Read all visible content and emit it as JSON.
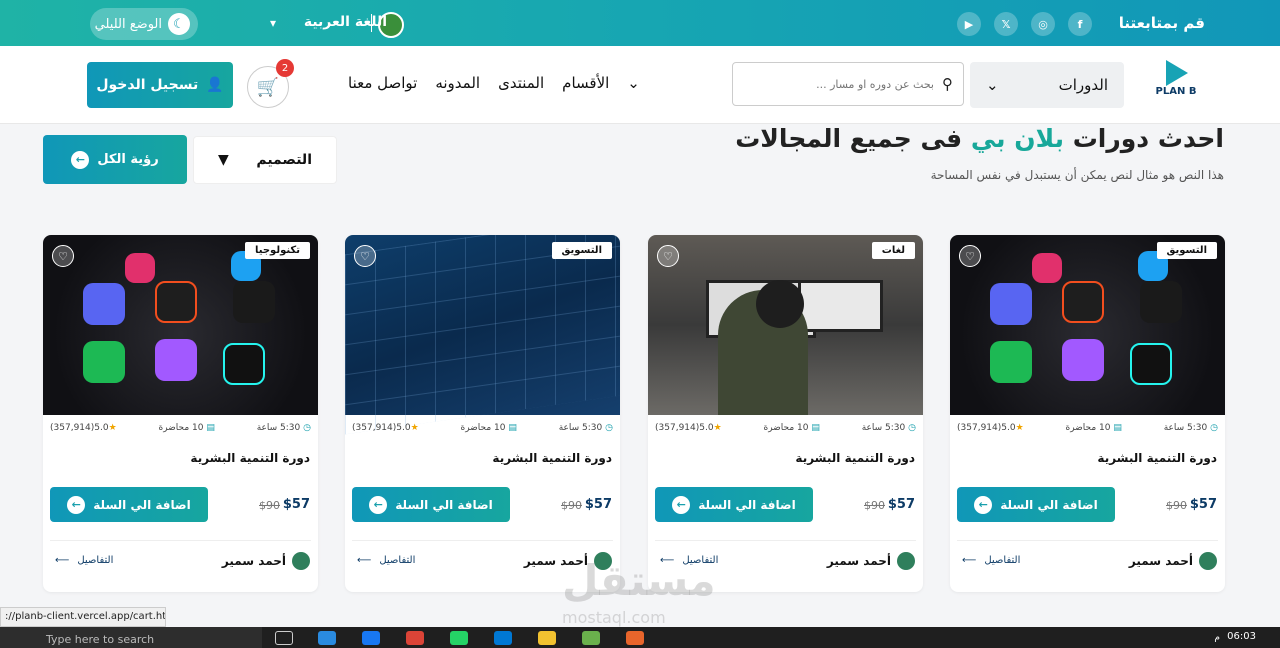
{
  "topbar": {
    "follow_label": "قم بمتابعتنا",
    "social": [
      "f",
      "◎",
      "𝕏",
      "▶"
    ],
    "language": "اللغة العربية",
    "night_mode": "الوضع الليلي"
  },
  "navbar": {
    "logo": "PLAN B",
    "courses_select": "الدورات",
    "search_placeholder": "بحث عن دوره او مسار ...",
    "links": [
      "الأقسام",
      "المنتدى",
      "المدونه",
      "تواصل معنا"
    ],
    "cart_count": "2",
    "login": "تسجيل الدخول"
  },
  "section": {
    "heading_part1": "احدث دورات ",
    "heading_accent": "بلان بي",
    "heading_part2": " فى جميع المجالات",
    "subheading": "هذا النص هو مثال لنص يمكن أن يستبدل في نفس المساحة",
    "filter": "التصميم",
    "see_all": "رؤية الكل"
  },
  "cards": [
    {
      "tag": "التسويق",
      "hours": "5:30 ساعة",
      "lectures": "10 محاضرة",
      "rating": "5.0",
      "reviews": "(357,914)",
      "title": "دورة التنمية البشرية",
      "price": "$57",
      "old_price": "$90",
      "add": "اضافة الي السلة",
      "author": "أحمد سمير",
      "details": "التفاصيل"
    },
    {
      "tag": "لغات",
      "hours": "5:30 ساعة",
      "lectures": "10 محاضرة",
      "rating": "5.0",
      "reviews": "(357,914)",
      "title": "دورة التنمية البشرية",
      "price": "$57",
      "old_price": "$90",
      "add": "اضافة الي السلة",
      "author": "أحمد سمير",
      "details": "التفاصيل"
    },
    {
      "tag": "التسويق",
      "hours": "5:30 ساعة",
      "lectures": "10 محاضرة",
      "rating": "5.0",
      "reviews": "(357,914)",
      "title": "دورة التنمية البشرية",
      "price": "$57",
      "old_price": "$90",
      "add": "اضافة الي السلة",
      "author": "أحمد سمير",
      "details": "التفاصيل"
    },
    {
      "tag": "تكنولوجيا",
      "hours": "5:30 ساعة",
      "lectures": "10 محاضرة",
      "rating": "5.0",
      "reviews": "(357,914)",
      "title": "دورة التنمية البشرية",
      "price": "$57",
      "old_price": "$90",
      "add": "اضافة الي السلة",
      "author": "أحمد سمير",
      "details": "التفاصيل"
    }
  ],
  "status_url": "://planb-client.vercel.app/cart.html",
  "taskbar": {
    "search": "Type here to search",
    "time": "06:03",
    "ampm": "م"
  },
  "watermark": {
    "arabic": "مستقل",
    "latin": "mostaql.com"
  },
  "colors": {
    "primary": "#1097b8",
    "accent": "#18a89a"
  }
}
